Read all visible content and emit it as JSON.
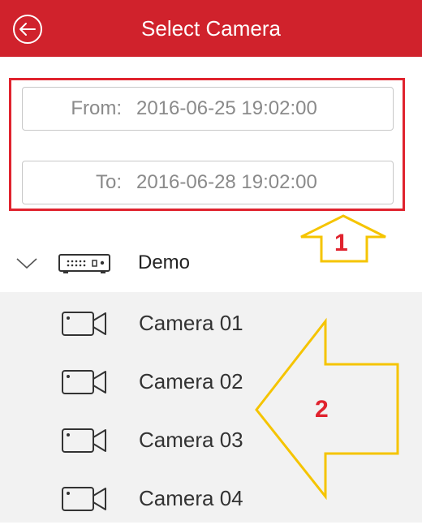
{
  "header": {
    "title": "Select Camera",
    "color": "#d0222c"
  },
  "filter": {
    "from_label": "From:",
    "from_value": "2016-06-25 19:02:00",
    "to_label": "To:",
    "to_value": "2016-06-28 19:02:00"
  },
  "device": {
    "name": "Demo"
  },
  "cameras": [
    {
      "label": "Camera 01"
    },
    {
      "label": "Camera 02"
    },
    {
      "label": "Camera 03"
    },
    {
      "label": "Camera 04"
    }
  ],
  "annotations": {
    "arrow_1": "1",
    "arrow_2": "2",
    "arrow_color": "#f5c400",
    "box_color": "#e0232e"
  }
}
